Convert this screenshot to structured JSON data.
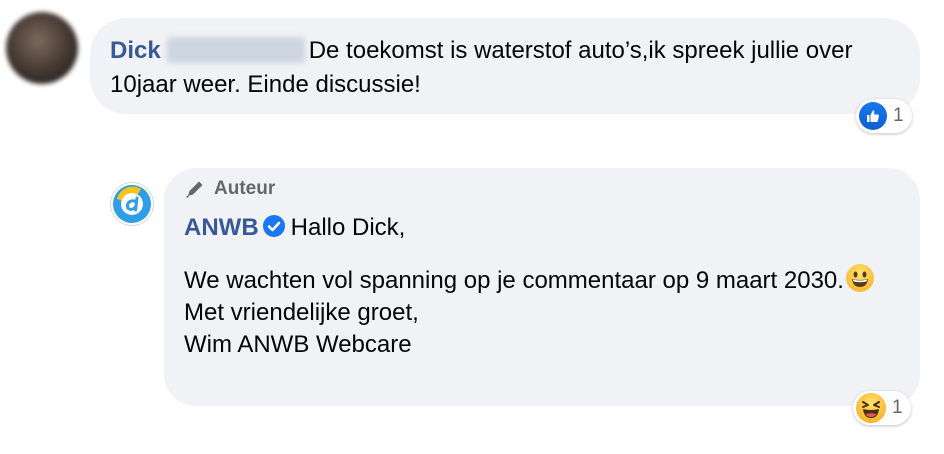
{
  "comment": {
    "author_name": "Dick",
    "text": "De toekomst is waterstof auto’s,ik spreek jullie over 10jaar weer. Einde discussie!",
    "reaction": {
      "type": "like",
      "icon": "like-icon",
      "count": "1"
    }
  },
  "reply": {
    "badge_label": "Auteur",
    "badge_icon": "pen-icon",
    "page_name": "ANWB",
    "verified_icon": "verified-badge-icon",
    "greeting": "Hallo Dick,",
    "body_line1": "We wachten vol spanning op je commentaar op 9 maart 2030.",
    "emoji": "grinning-face-emoji",
    "closing": "Met vriendelijke groet,",
    "signature": "Wim ANWB Webcare",
    "reaction": {
      "type": "haha",
      "icon": "haha-icon",
      "count": "1"
    }
  },
  "colors": {
    "bubble_bg": "#f0f2f5",
    "name_blue": "#385898",
    "like_blue": "#1877f2",
    "meta_gray": "#65676b"
  }
}
